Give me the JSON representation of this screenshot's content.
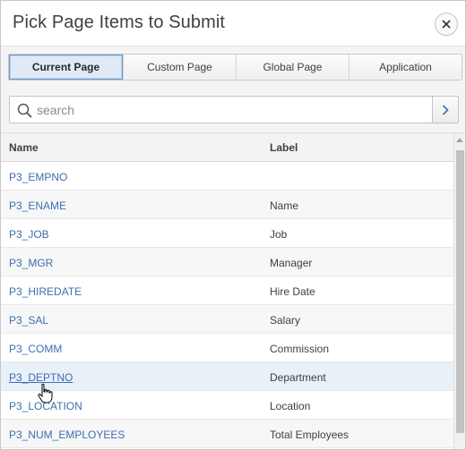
{
  "dialog": {
    "title": "Pick Page Items to Submit",
    "close_icon": "close-icon"
  },
  "tabs": [
    {
      "label": "Current Page",
      "active": true
    },
    {
      "label": "Custom Page",
      "active": false
    },
    {
      "label": "Global Page",
      "active": false
    },
    {
      "label": "Application",
      "active": false
    }
  ],
  "search": {
    "placeholder": "search",
    "value": "",
    "icon": "search-icon",
    "go_icon": "chevron-right-icon"
  },
  "table": {
    "columns": [
      "Name",
      "Label"
    ],
    "rows": [
      {
        "name": "P3_EMPNO",
        "label": ""
      },
      {
        "name": "P3_ENAME",
        "label": "Name"
      },
      {
        "name": "P3_JOB",
        "label": "Job"
      },
      {
        "name": "P3_MGR",
        "label": "Manager"
      },
      {
        "name": "P3_HIREDATE",
        "label": "Hire Date"
      },
      {
        "name": "P3_SAL",
        "label": "Salary"
      },
      {
        "name": "P3_COMM",
        "label": "Commission"
      },
      {
        "name": "P3_DEPTNO",
        "label": "Department"
      },
      {
        "name": "P3_LOCATION",
        "label": "Location"
      },
      {
        "name": "P3_NUM_EMPLOYEES",
        "label": "Total Employees"
      }
    ],
    "hovered_row": "P3_DEPTNO"
  },
  "colors": {
    "link": "#3c6fb1",
    "active_tab_bg": "#dfeaf6",
    "active_tab_border": "#6f9bd0"
  }
}
